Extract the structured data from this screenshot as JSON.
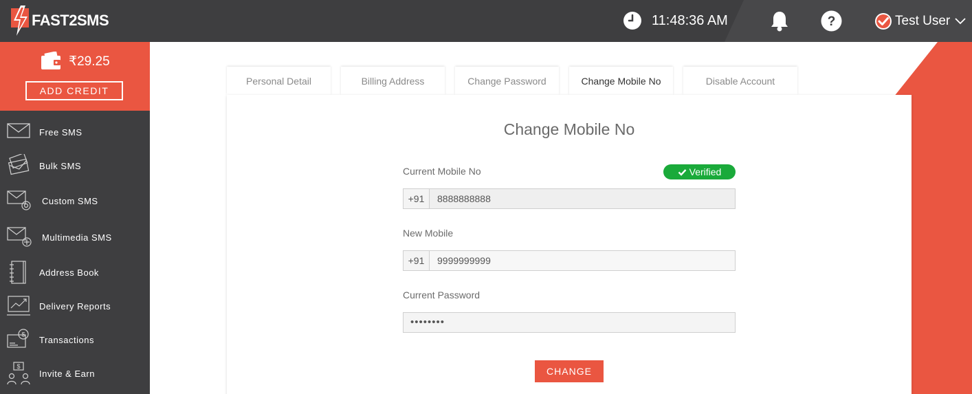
{
  "brand": {
    "name": "FAST2SMS"
  },
  "header": {
    "time": "11:48:36 AM",
    "user_name": "Test User"
  },
  "wallet": {
    "amount": "₹29.25",
    "add_credit_label": "ADD CREDIT"
  },
  "sidebar": {
    "items": [
      {
        "label": "Free SMS",
        "icon": "envelope-icon"
      },
      {
        "label": "Bulk SMS",
        "icon": "stacked-envelopes-icon"
      },
      {
        "label": "Custom SMS",
        "icon": "envelope-gear-icon"
      },
      {
        "label": "Multimedia SMS",
        "icon": "envelope-plus-icon"
      },
      {
        "label": "Address Book",
        "icon": "address-book-icon"
      },
      {
        "label": "Delivery Reports",
        "icon": "chart-report-icon"
      },
      {
        "label": "Transactions",
        "icon": "transactions-icon"
      },
      {
        "label": "Invite & Earn",
        "icon": "invite-people-icon"
      }
    ]
  },
  "tabs": [
    {
      "label": "Personal Detail"
    },
    {
      "label": "Billing Address"
    },
    {
      "label": "Change Password"
    },
    {
      "label": "Change Mobile No"
    },
    {
      "label": "Disable Account"
    }
  ],
  "form": {
    "title": "Change Mobile No",
    "current_mobile_label": "Current Mobile No",
    "verified_label": "Verified",
    "current_prefix": "+91",
    "current_mobile_value": "8888888888",
    "new_mobile_label": "New Mobile",
    "new_prefix": "+91",
    "new_mobile_value": "9999999999",
    "current_password_label": "Current Password",
    "password_value": "••••••••",
    "submit_label": "CHANGE"
  },
  "colors": {
    "accent": "#ea5641",
    "dark": "#3e3e40",
    "verified": "#1aaa3a"
  }
}
